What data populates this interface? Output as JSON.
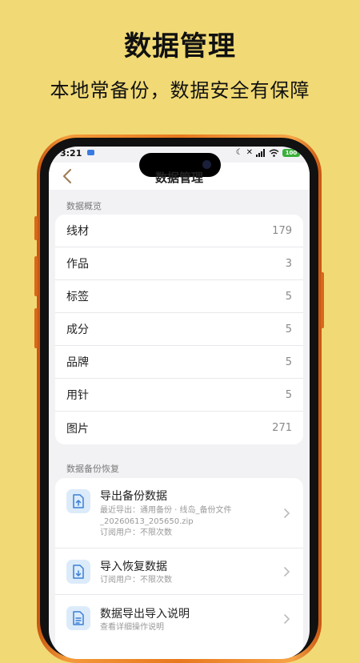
{
  "hero": {
    "title": "数据管理",
    "subtitle": "本地常备份，数据安全有保障"
  },
  "status_bar": {
    "time": "3:21",
    "battery": "100"
  },
  "nav": {
    "title": "数据管理"
  },
  "overview": {
    "header": "数据概览",
    "rows": [
      {
        "label": "线材",
        "value": "179"
      },
      {
        "label": "作品",
        "value": "3"
      },
      {
        "label": "标签",
        "value": "5"
      },
      {
        "label": "成分",
        "value": "5"
      },
      {
        "label": "品牌",
        "value": "5"
      },
      {
        "label": "用针",
        "value": "5"
      },
      {
        "label": "图片",
        "value": "271"
      }
    ]
  },
  "backup": {
    "header": "数据备份恢复",
    "export": {
      "title": "导出备份数据",
      "desc_line1": "最近导出：通用备份 · 线岛_备份文件",
      "desc_line2": "_20260613_205650.zip",
      "desc_line3": "订阅用户：不限次数"
    },
    "import": {
      "title": "导入恢复数据",
      "desc": "订阅用户：不限次数"
    },
    "guide": {
      "title": "数据导出导入说明",
      "desc": "查看详细操作说明"
    }
  },
  "colors": {
    "background": "#F1DA75",
    "phone_frame": "#E8781E",
    "icon_bg": "#DCEBFA",
    "icon_fg": "#3B7FD4"
  }
}
